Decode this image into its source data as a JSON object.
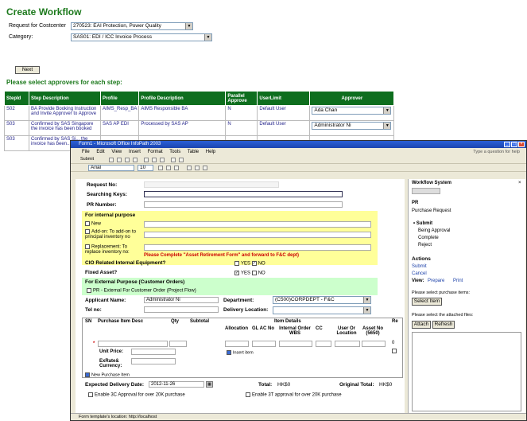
{
  "page": {
    "title": "Create Workflow",
    "request_label": "Request for Costcenter",
    "request_value": "270523: EAI Protection, Power Quality",
    "category_label": "Category:",
    "category_value": "SAS01: EDI / ICC Invoice Process",
    "next_button": "Next",
    "approvers_heading": "Please select approvers for each step:"
  },
  "approvers_table": {
    "headers": [
      "StepId",
      "Step Description",
      "Profile",
      "Profile Description",
      "Parallel Approve",
      "UserLimit",
      "Approver"
    ],
    "rows": [
      {
        "step": "S02",
        "desc": "BA Provide Booking Instruction and Invite Approver to Approve",
        "profile": "AIMS_Resp_BA",
        "profile_desc": "AIMS Responsible BA",
        "parallel": "N",
        "limit": "Default User",
        "approver": "Ada Chan"
      },
      {
        "step": "S03",
        "desc": "Confirmed by SAS Singapore the invoice has been booked",
        "profile": "SAS AP EDI",
        "profile_desc": "Processed by SAS AP",
        "parallel": "N",
        "limit": "Default User",
        "approver": "Administrator Ni"
      },
      {
        "step": "S03",
        "desc": "Confirmed by SAS Si... the invoice has been...",
        "profile": "",
        "profile_desc": "",
        "parallel": "",
        "limit": "",
        "approver": ""
      }
    ]
  },
  "infopath": {
    "title": "Form1 - Microsoft Office InfoPath 2003",
    "menu": [
      "File",
      "Edit",
      "View",
      "Insert",
      "Format",
      "Tools",
      "Table",
      "Help"
    ],
    "help_box": "Type a question for help",
    "toolbar_submit": "Submit",
    "font_name": "Arial",
    "font_size": "10",
    "form": {
      "request_no_label": "Request No:",
      "searching_keys_label": "Searching Keys:",
      "pr_number_label": "PR Number:",
      "internal_heading": "For internal purpose",
      "new_label": "New",
      "addon_label": "Add-on: To add-on to principal inventory no",
      "replacement_label": "Replacement: To replace inventory no:",
      "retirement_note": "Please Complete \"Asset Retirement Form\" and forward to F&C dept)",
      "cio_label": "CIO Related Internal Equipment?",
      "fixed_asset_label": "Fixed Asset?",
      "yes": "YES",
      "no": "NO",
      "external_heading": "For External Purpose (Customer Orders)",
      "pr_external_label": "PR - External For Customer Order (Project Flow)",
      "applicant_label": "Applicant Name:",
      "applicant_value": "Administrator Ni",
      "department_label": "Department:",
      "department_value": "(C500)CORPDEPT - F&C",
      "tel_label": "Tel no:",
      "delivery_location_label": "Delivery Location:",
      "col_sn": "SN",
      "col_desc": "Purchase Item Desc",
      "col_qty": "Qty",
      "col_subtotal": "Subtotal",
      "col_item_details": "Item Details",
      "col_allocation": "Allocation",
      "col_glac": "GL AC No",
      "col_internal_order": "Internal Order WBS",
      "col_cc": "CC",
      "col_user_location": "User Or Location",
      "col_asset_no": "Asset No (5650)",
      "col_re": "Re",
      "unit_price_label": "Unit Price:",
      "exrate_label": "ExRate& Currency:",
      "insert_item": "Insert item",
      "new_purchase_item": "New Purchase Item",
      "zero": "0",
      "expected_delivery_label": "Expected Delivery Date:",
      "expected_delivery_value": "2012-11-26",
      "total_label": "Total:",
      "total_value": "HK$0",
      "original_total_label": "Original Total:",
      "original_total_value": "HK$0",
      "enable_3c": "Enable 3C Approval for over 20K purchase",
      "enable_3t": "Enable 3T approval for over 20K purchase"
    },
    "pane": {
      "title": "Workflow System",
      "pr": "PR",
      "pr_desc": "Purchase Request",
      "states": [
        "Submit",
        "Being Approval",
        "Complete",
        "Reject"
      ],
      "actions_heading": "Actions",
      "actions": [
        "Submit",
        "Cancel"
      ],
      "view_label": "View:",
      "view_prepare": "Prepare",
      "view_print": "Print",
      "select_items_label": "Please select purchase items:",
      "select_item_button": "Select Item",
      "attached_label": "Please select the attached files:",
      "attach_button": "Attach",
      "refresh_button": "Refresh"
    },
    "status": "Form template's location: http://localhost"
  }
}
